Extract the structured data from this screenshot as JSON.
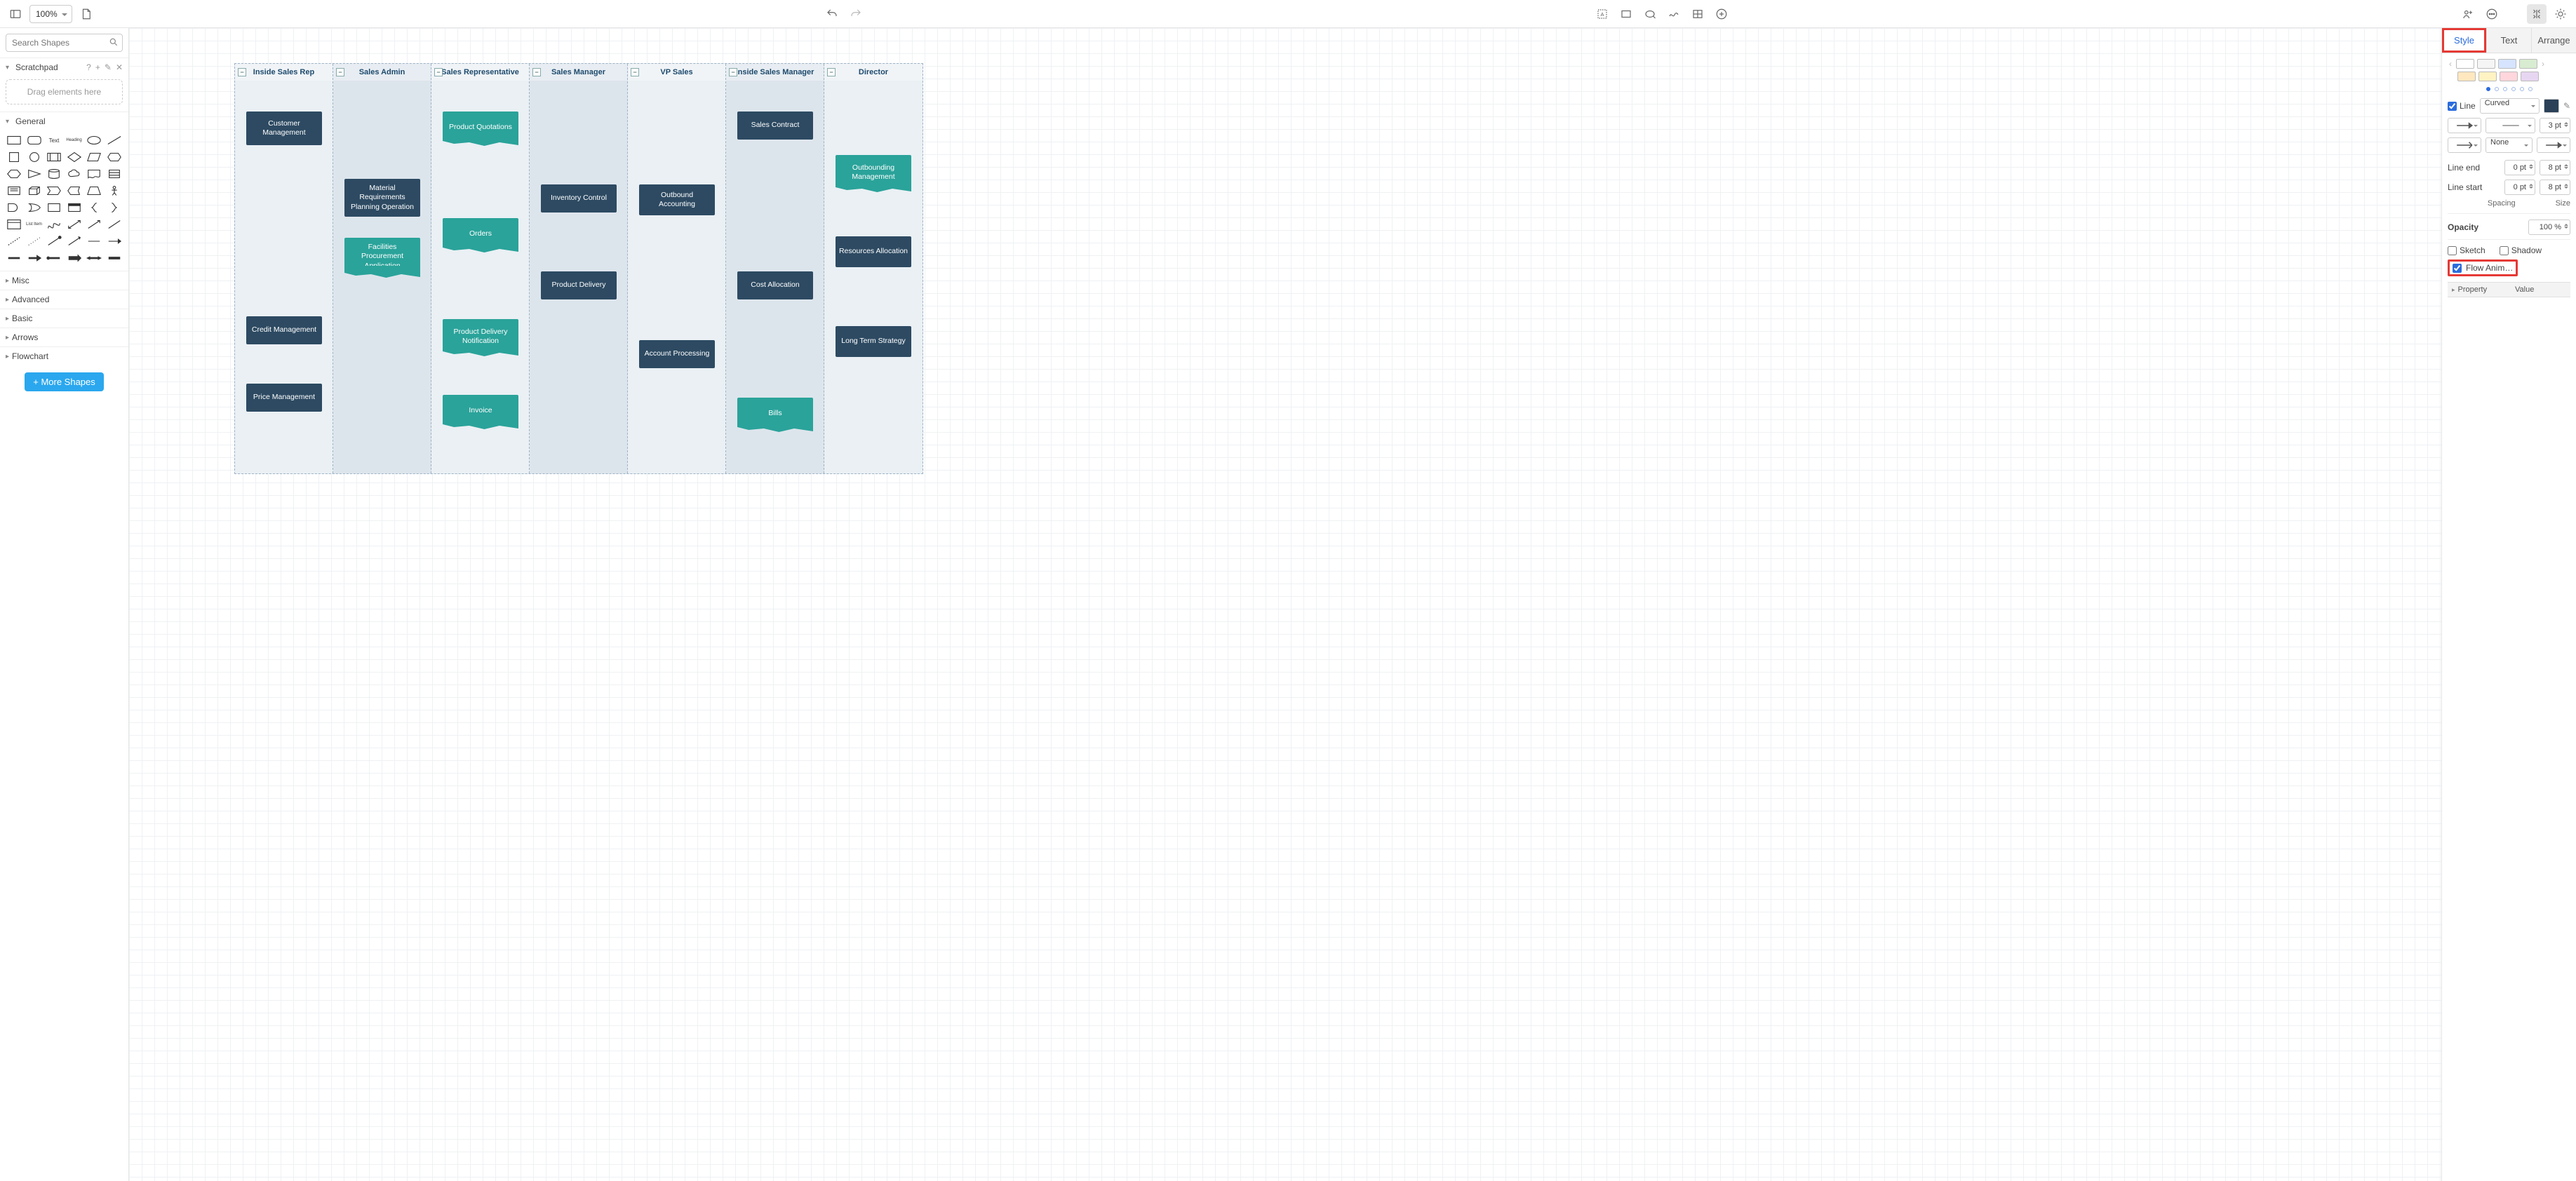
{
  "toolbar": {
    "zoom": "100%"
  },
  "left": {
    "search_placeholder": "Search Shapes",
    "scratchpad": {
      "title": "Scratchpad",
      "drop_hint": "Drag elements here"
    },
    "general_title": "General",
    "text_label": "Text",
    "heading_label": "Heading",
    "list_label": "List Item",
    "categories": [
      "Misc",
      "Advanced",
      "Basic",
      "Arrows",
      "Flowchart"
    ],
    "more_shapes": "+ More Shapes"
  },
  "right": {
    "tabs": {
      "style": "Style",
      "text": "Text",
      "arrange": "Arrange"
    },
    "swatches_row1": [
      "#ffffff",
      "#f5f5f5",
      "#d6e4ff",
      "#d7ecd0"
    ],
    "swatches_row2": [
      "#ffe7bf",
      "#fff3c4",
      "#ffd6dc",
      "#e7d6f2"
    ],
    "line_label": "Line",
    "line_style": "Curved",
    "line_color": "#2a4158",
    "line_weight": "3 pt",
    "fill_none": "None",
    "line_end_label": "Line end",
    "line_end_a": "0 pt",
    "line_end_b": "8 pt",
    "line_start_label": "Line start",
    "line_start_a": "0 pt",
    "line_start_b": "8 pt",
    "spacing_label": "Spacing",
    "size_label": "Size",
    "opacity_label": "Opacity",
    "opacity_value": "100 %",
    "sketch": "Sketch",
    "shadow": "Shadow",
    "flow_anim": "Flow Anim…",
    "property": "Property",
    "value": "Value"
  },
  "diagram": {
    "lanes": [
      "Inside Sales Rep",
      "Sales Admin",
      "Sales Representative",
      "Sales Manager",
      "VP Sales",
      "Inside Sales Manager",
      "Director"
    ],
    "nodes": {
      "customer_mgmt": "Customer Management",
      "product_quotations": "Product Quotations",
      "sales_contract": "Sales Contract",
      "outbound_mgmt": "Outbounding Management",
      "mrp": "Material Requirements Planning Operation",
      "inventory_control": "Inventory Control",
      "outbound_accounting": "Outbound Accounting",
      "facilities": "Facilities Procurement Application",
      "orders": "Orders",
      "resources_alloc": "Resources Allocation",
      "cost_alloc": "Cost Allocation",
      "product_delivery": "Product Delivery",
      "credit_mgmt": "Credit Management",
      "product_delivery_notif": "Product Delivery Notification",
      "account_processing": "Account Processing",
      "long_term": "Long Term Strategy",
      "price_mgmt": "Price Management",
      "invoice": "Invoice",
      "bills": "Bills"
    }
  }
}
